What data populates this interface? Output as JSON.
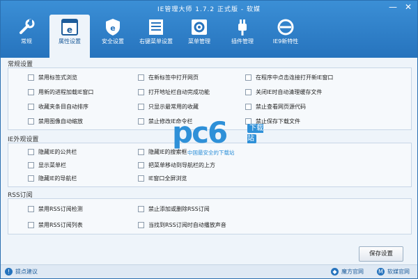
{
  "window": {
    "title": "IE管理大师 1.7.2 正式版 - 软媒",
    "min_glyph": "—",
    "close_glyph": "✕"
  },
  "toolbar": {
    "items": [
      {
        "label": "常规",
        "icon": "wrench-icon"
      },
      {
        "label": "属性设置",
        "icon": "ie-window-icon"
      },
      {
        "label": "安全设置",
        "icon": "ie-shield-icon"
      },
      {
        "label": "右键菜单设置",
        "icon": "menu-list-icon"
      },
      {
        "label": "菜单管理",
        "icon": "gear-box-icon"
      },
      {
        "label": "插件管理",
        "icon": "plug-icon"
      },
      {
        "label": "IE9新特性",
        "icon": "ie9-icon"
      }
    ],
    "active_index": 1
  },
  "sections": {
    "general": {
      "title": "常规设置",
      "items": [
        "禁用标签式浏览",
        "在新标签中打开网页",
        "在程序中点击连接打开新IE窗口",
        "用新的进程加载IE窗口",
        "打开地址栏自动完成功能",
        "关闭IE时自动清理缓存文件",
        "收藏夹条目自动排序",
        "只显示最常用的收藏",
        "禁止查看网页源代码",
        "禁用图像自动缩放",
        "禁止修改IE命令栏",
        "禁止保存下载文件"
      ]
    },
    "appearance": {
      "title": "IE外观设置",
      "items": [
        "隐藏IE的公共栏",
        "隐藏IE的搜索框",
        "显示菜单栏",
        "把菜单移动到导航栏的上方",
        "隐藏IE的导航栏",
        "IE窗口全屏浏览"
      ]
    },
    "rss": {
      "title": "RSS订阅",
      "items": [
        "禁用RSS订阅检测",
        "禁止添加或删除RSS订阅",
        "禁用RSS订阅列表",
        "当找到RSS订阅时自动播放声音"
      ]
    }
  },
  "save_button": "保存设置",
  "watermark": {
    "logo": "pc6",
    "tag": "下载站",
    "sub": "中国最安全的下载站"
  },
  "statusbar": {
    "suggest": "提点建议",
    "site1": "魔方官网",
    "site2": "软媒官网"
  },
  "colors": {
    "accent": "#2673bd",
    "watermark": "#2e90d8"
  }
}
